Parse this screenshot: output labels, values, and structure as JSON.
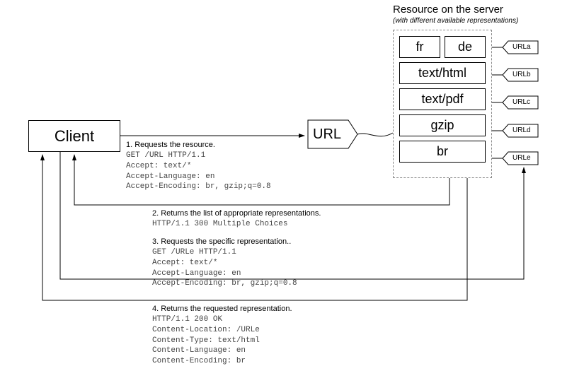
{
  "client": {
    "label": "Client"
  },
  "url": {
    "label": "URL"
  },
  "server": {
    "title": "Resource on the server",
    "subtitle": "(with different available representations)",
    "rows": [
      {
        "cells": [
          "fr",
          "de"
        ],
        "tag": "URLa"
      },
      {
        "cells": [
          "text/html"
        ],
        "tag": "URLb"
      },
      {
        "cells": [
          "text/pdf"
        ],
        "tag": "URLc"
      },
      {
        "cells": [
          "gzip"
        ],
        "tag": "URLd"
      },
      {
        "cells": [
          "br"
        ],
        "tag": "URLe"
      }
    ]
  },
  "steps": {
    "s1": {
      "title": "1. Requests the resource.",
      "lines": "GET /URL HTTP/1.1\nAccept: text/*\nAccept-Language: en\nAccept-Encoding: br, gzip;q=0.8"
    },
    "s2": {
      "title": "2. Returns the list of  appropriate representations.",
      "lines": "HTTP/1.1 300 Multiple Choices"
    },
    "s3": {
      "title": "3. Requests the specific representation..",
      "lines": "GET /URLe HTTP/1.1\nAccept: text/*\nAccept-Language: en\nAccept-Encoding: br, gzip;q=0.8"
    },
    "s4": {
      "title": "4. Returns the requested representation.",
      "lines": "HTTP/1.1 200 OK\nContent-Location: /URLe\nContent-Type: text/html\nContent-Language: en\nContent-Encoding: br"
    }
  }
}
